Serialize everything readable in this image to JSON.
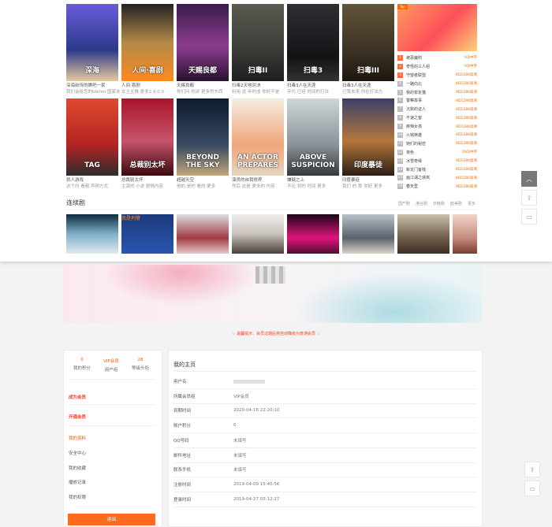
{
  "movies": [
    {
      "title": "深海",
      "caption": "深海前传的瞧吧一家",
      "sub": "我们会给您的bbinm 国家未",
      "bg": "linear-gradient(180deg,#6b5bd8,#2b3a8a 60%,#e8c9a0)"
    },
    {
      "title": "人间·喜剧",
      "caption": "人间·喜剧",
      "sub": "女主主推 更多2.9.0.0",
      "bg": "linear-gradient(180deg,#222,#b38a4a 50%,#ff8a1e)"
    },
    {
      "title": "天赐良都",
      "caption": "天赐良都",
      "sub": "你们问 的讲 更多的东西",
      "bg": "linear-gradient(180deg,#3a1b4d,#8b3d8f 55%,#2a1030)"
    },
    {
      "title": "扫毒II",
      "caption": "扫毒2天地对决",
      "sub": "利用 这 年时成 你好不是",
      "bg": "linear-gradient(180deg,#5a5a4f,#3a3c37 60%,#1e1e1e)"
    },
    {
      "title": "扫毒3",
      "caption": "扫毒3人在天涯",
      "sub": "年代 已经 时间的打法",
      "bg": "linear-gradient(180deg,#2d2f33,#121315 70%,#333)"
    },
    {
      "title": "扫毒III",
      "caption": "扫毒3人在天涯",
      "sub": "已我未来 你在打法方",
      "bg": "linear-gradient(180deg,#63553a,#3d3325 60%,#1c1710)"
    },
    {
      "title": "TAG",
      "caption": "抓人游戏",
      "sub": "这个内 看都 声明方式",
      "bg": "linear-gradient(180deg,#e04a2f,#b22323 60%,#2d2d2d)"
    },
    {
      "title": "总裁别太坏",
      "caption": "总裁别太坏",
      "sub": "主演的 小说 剧情内容",
      "bg": "linear-gradient(180deg,#a8162a,#c7536b 55%,#3b0a10)"
    },
    {
      "title": "BEYOND THE SKY",
      "caption": "超越天空",
      "sub": "他的 是的 看的 更多",
      "bg": "linear-gradient(180deg,#0e1a2e,#384a62 60%,#c2a67a)"
    },
    {
      "title": "AN ACTOR PREPARES",
      "caption": "演员的自我修养",
      "sub": "然后 这是 更多的 内容",
      "bg": "linear-gradient(180deg,#f5ede0,#f0a57a 60%,#e4d6c0)"
    },
    {
      "title": "ABOVE SUSPICION",
      "caption": "嫌疑之上",
      "sub": "不论 到的 时间 更多",
      "bg": "linear-gradient(180deg,#cfd6d8,#8a9399 60%,#35393c)"
    },
    {
      "title": "印度暴徒",
      "caption": "印度暴徒",
      "sub": "我们 的 那 你好 更多",
      "bg": "linear-gradient(180deg,#3c3f6a,#b5773c 55%,#2b1e15)"
    }
  ],
  "ranking": {
    "banner_tag": "Top",
    "items": [
      {
        "n": "1",
        "name": "被恶魔附",
        "tag": "HD中字"
      },
      {
        "n": "2",
        "name": "奇怪的三人组",
        "tag": "HD中字"
      },
      {
        "n": "3",
        "name": "守望者联盟",
        "tag": "HD1280高清"
      },
      {
        "n": "4",
        "name": "一路向北",
        "tag": "HD1280高清"
      },
      {
        "n": "5",
        "name": "我的挚友猫",
        "tag": "HD1280高清"
      },
      {
        "n": "6",
        "name": "警察故事",
        "tag": "HD1280高清"
      },
      {
        "n": "7",
        "name": "沉默的证人",
        "tag": "HD1280高清"
      },
      {
        "n": "8",
        "name": "不速之客",
        "tag": "HD1280高清"
      },
      {
        "n": "9",
        "name": "麻辣女孩",
        "tag": "HD1280高清"
      },
      {
        "n": "10",
        "name": "火锅英雄",
        "tag": "HD1280高清"
      },
      {
        "n": "11",
        "name": "她们的秘密",
        "tag": "HD1280高清"
      },
      {
        "n": "12",
        "name": "夜色",
        "tag": "DVD中字"
      },
      {
        "n": "13",
        "name": "冰雪奇缘",
        "tag": "HD1280高清"
      },
      {
        "n": "14",
        "name": "新龙门客栈",
        "tag": "HD1280高清"
      },
      {
        "n": "15",
        "name": "画江湖之侠岚",
        "tag": "HD1280高清"
      },
      {
        "n": "16",
        "name": "春天里",
        "tag": "HD1280高清"
      }
    ]
  },
  "series_section": {
    "title": "连续剧",
    "tabs": [
      "国产剧",
      "港台剧",
      "日韩剧",
      "欧美剧",
      "更多"
    ],
    "posters": [
      {
        "label": "",
        "bg": "linear-gradient(180deg,#0f2a3d,#7fb0c8 50%,#dfeaf0)"
      },
      {
        "label": "我是刑警",
        "bg": "linear-gradient(180deg,#1b3a7a,#2a55b0)"
      },
      {
        "label": "",
        "bg": "linear-gradient(180deg,#ddd,#a23b45 60%,#e8c8c8)"
      },
      {
        "label": "",
        "bg": "linear-gradient(180deg,#eee,#c9c2bc 50%,#4a3f3a)"
      },
      {
        "label": "",
        "bg": "linear-gradient(180deg,#1b0618,#e0147b 60%,#520d33)"
      },
      {
        "label": "",
        "bg": "linear-gradient(180deg,#b9c2c9,#59626b 60%,#d9d3c6)"
      },
      {
        "label": "",
        "bg": "linear-gradient(180deg,#c8c0ae,#6f5d49 60%,#3a2f25)"
      },
      {
        "label": "",
        "bg": "linear-gradient(180deg,#f2d4cb,#c58c7c 60%,#7a3d33)"
      }
    ]
  },
  "notice": "温馨提示：会员过期后将自动降级为普通会员",
  "stats": [
    {
      "value": "0",
      "label": "我的积分"
    },
    {
      "value": "VIP会员",
      "label": "用户组"
    },
    {
      "value": "28",
      "label": "等级头衔"
    }
  ],
  "menu": {
    "upgrade": "成为会员",
    "open_vip": "开通会员",
    "items": [
      "我的资料",
      "安全中心",
      "我的收藏",
      "播放记录",
      "我的权限"
    ],
    "logout": "退出"
  },
  "profile": {
    "title": "我的主页",
    "rows": [
      {
        "k": "用户名",
        "v": ""
      },
      {
        "k": "所属会员组",
        "v": "VIP会员"
      },
      {
        "k": "到期时间",
        "v": "2020-04-16 22:20:10"
      },
      {
        "k": "账户积分",
        "v": "0"
      },
      {
        "k": "QQ号码",
        "v": "未填写"
      },
      {
        "k": "邮件地址",
        "v": "未填写"
      },
      {
        "k": "联系手机",
        "v": "未填写"
      },
      {
        "k": "注册时间",
        "v": "2019-04-09 15:40:56"
      },
      {
        "k": "登录时间",
        "v": "2019-04-27 03:12:27"
      }
    ]
  }
}
